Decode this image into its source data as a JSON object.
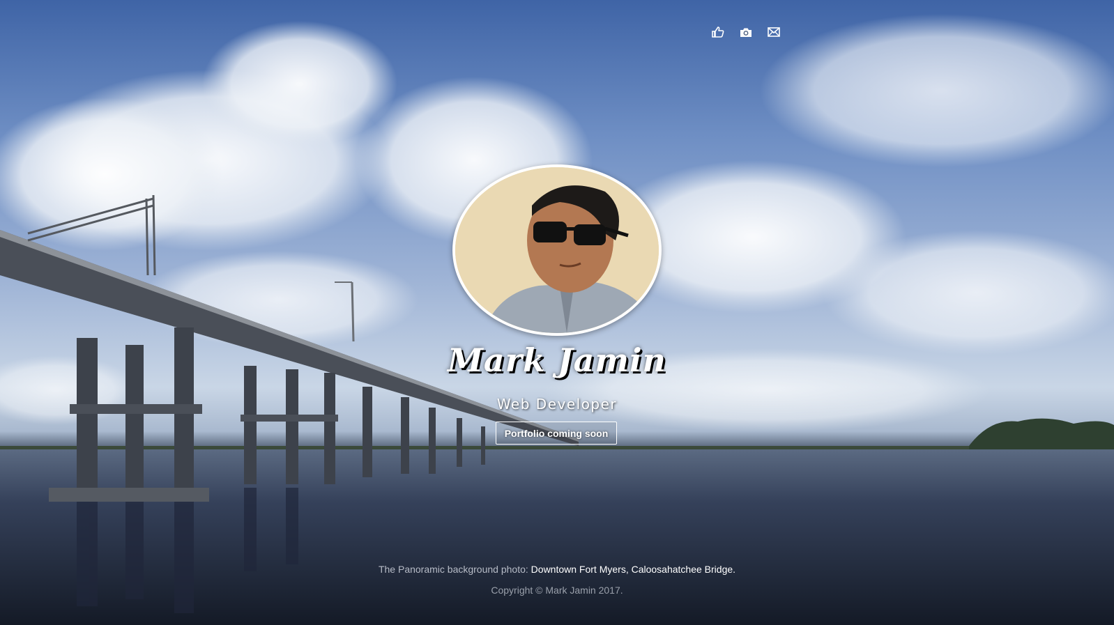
{
  "top_icons": [
    {
      "name": "thumbs-up-icon"
    },
    {
      "name": "camera-icon"
    },
    {
      "name": "envelope-icon"
    }
  ],
  "profile": {
    "name": "Mark Jamin",
    "role": "Web Developer",
    "cta_label": "Portfolio coming soon"
  },
  "footer": {
    "credit_prefix": "The Panoramic background photo:",
    "credit_link": "Downtown Fort Myers, Caloosahatchee Bridge.",
    "copyright": "Copyright © Mark Jamin 2017."
  },
  "colors": {
    "sky": "#6f8fc4",
    "water": "#2b3546",
    "text": "#ffffff"
  }
}
